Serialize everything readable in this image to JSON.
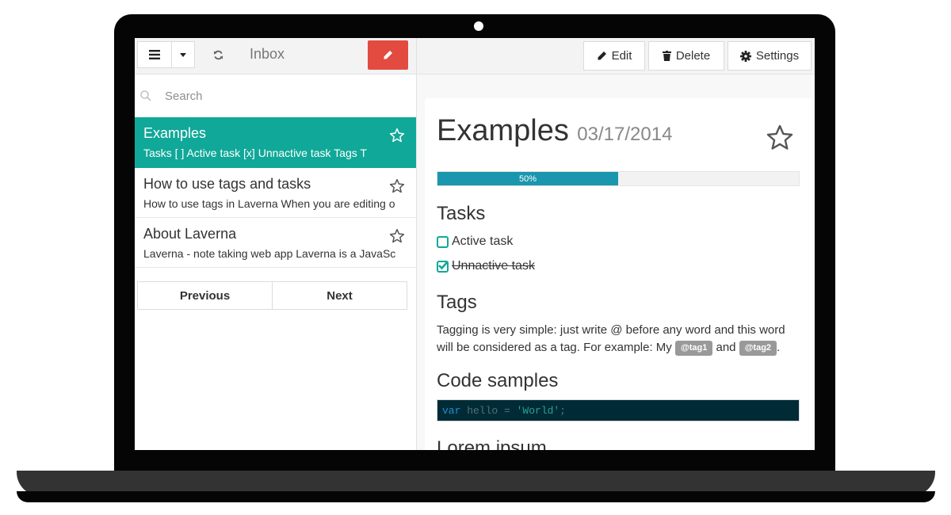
{
  "sidebar": {
    "toolbar": {
      "menu_icon": "menu-icon",
      "dropdown_icon": "caret-down-icon",
      "sync_icon": "refresh-icon",
      "title": "Inbox",
      "new_note_icon": "pencil-icon"
    },
    "search": {
      "placeholder": "Search"
    },
    "notes": [
      {
        "title": "Examples",
        "preview": "Tasks [ ] Active task [x] Unnactive task Tags T",
        "starred": false,
        "active": true
      },
      {
        "title": "How to use tags and tasks",
        "preview": "How to use tags in Laverna When you are editing o",
        "starred": false,
        "active": false
      },
      {
        "title": "About Laverna",
        "preview": "Laverna - note taking web app Laverna is a JavaSc",
        "starred": false,
        "active": false
      }
    ],
    "pager": {
      "previous": "Previous",
      "next": "Next"
    }
  },
  "content": {
    "toolbar": {
      "edit": "Edit",
      "delete": "Delete",
      "settings": "Settings"
    },
    "note": {
      "title": "Examples",
      "date": "03/17/2014",
      "progress": {
        "label": "50%",
        "value": 0.5
      },
      "tasks_heading": "Tasks",
      "tasks": [
        {
          "label": "Active task",
          "done": false
        },
        {
          "label": "Unnactive task",
          "done": true
        }
      ],
      "tags_heading": "Tags",
      "tags_text_1": "Tagging is very simple: just write @ before any word and this word will be considered as a tag. For example: My",
      "tag1": "@tag1",
      "tags_and": "and",
      "tag2": "@tag2",
      "tags_end": ".",
      "code_heading": "Code samples",
      "code": {
        "kw": "var",
        "mid": " hello = ",
        "str": "'World'",
        "end": ";"
      },
      "next_heading": "Lorem ipsum"
    }
  },
  "colors": {
    "accent": "#10a898",
    "new_button": "#e34b40",
    "progress": "#1a96ae",
    "code_bg": "#002b36"
  }
}
